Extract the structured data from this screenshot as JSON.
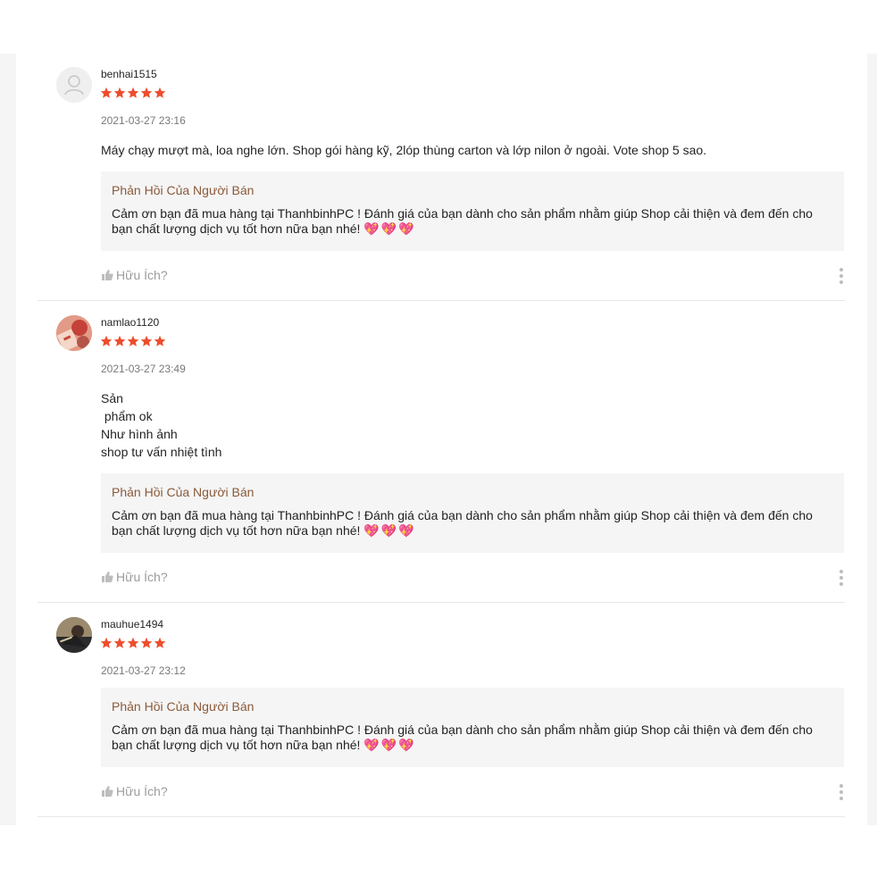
{
  "accent_star_color": "#ee4d2d",
  "reviews": [
    {
      "username": "benhai1515",
      "rating": 5,
      "datetime": "2021-03-27 23:16",
      "content": "Máy chạy mượt mà, loa nghe lớn. Shop gói hàng kỹ, 2lóp thùng carton và lớp nilon ở ngoài. Vote shop 5 sao.",
      "reply_title": "Phản Hồi Của Người Bán",
      "reply_text": "Cảm ơn bạn đã mua hàng tại ThanhbinhPC ! Đánh giá của bạn dành cho sản phẩm nhằm giúp Shop cải thiện và đem đến cho bạn chất lượng dịch vụ tốt hơn nữa bạn nhé!",
      "reply_hearts": "💖💖💖",
      "helpful_label": "Hữu Ích?"
    },
    {
      "username": "namlao1120",
      "rating": 5,
      "datetime": "2021-03-27 23:49",
      "content": "Sản\n phẩm ok\nNhư hình ảnh\nshop tư vấn nhiệt tình",
      "reply_title": "Phản Hồi Của Người Bán",
      "reply_text": "Cảm ơn bạn đã mua hàng tại ThanhbinhPC ! Đánh giá của bạn dành cho sản phẩm nhằm giúp Shop cải thiện và đem đến cho bạn chất lượng dịch vụ tốt hơn nữa bạn nhé!",
      "reply_hearts": "💖💖💖",
      "helpful_label": "Hữu Ích?"
    },
    {
      "username": "mauhue1494",
      "rating": 5,
      "datetime": "2021-03-27 23:12",
      "content": "",
      "reply_title": "Phản Hồi Của Người Bán",
      "reply_text": "Cảm ơn bạn đã mua hàng tại ThanhbinhPC ! Đánh giá của bạn dành cho sản phẩm nhằm giúp Shop cải thiện và đem đến cho bạn chất lượng dịch vụ tốt hơn nữa bạn nhé!",
      "reply_hearts": "💖💖💖",
      "helpful_label": "Hữu Ích?"
    }
  ]
}
